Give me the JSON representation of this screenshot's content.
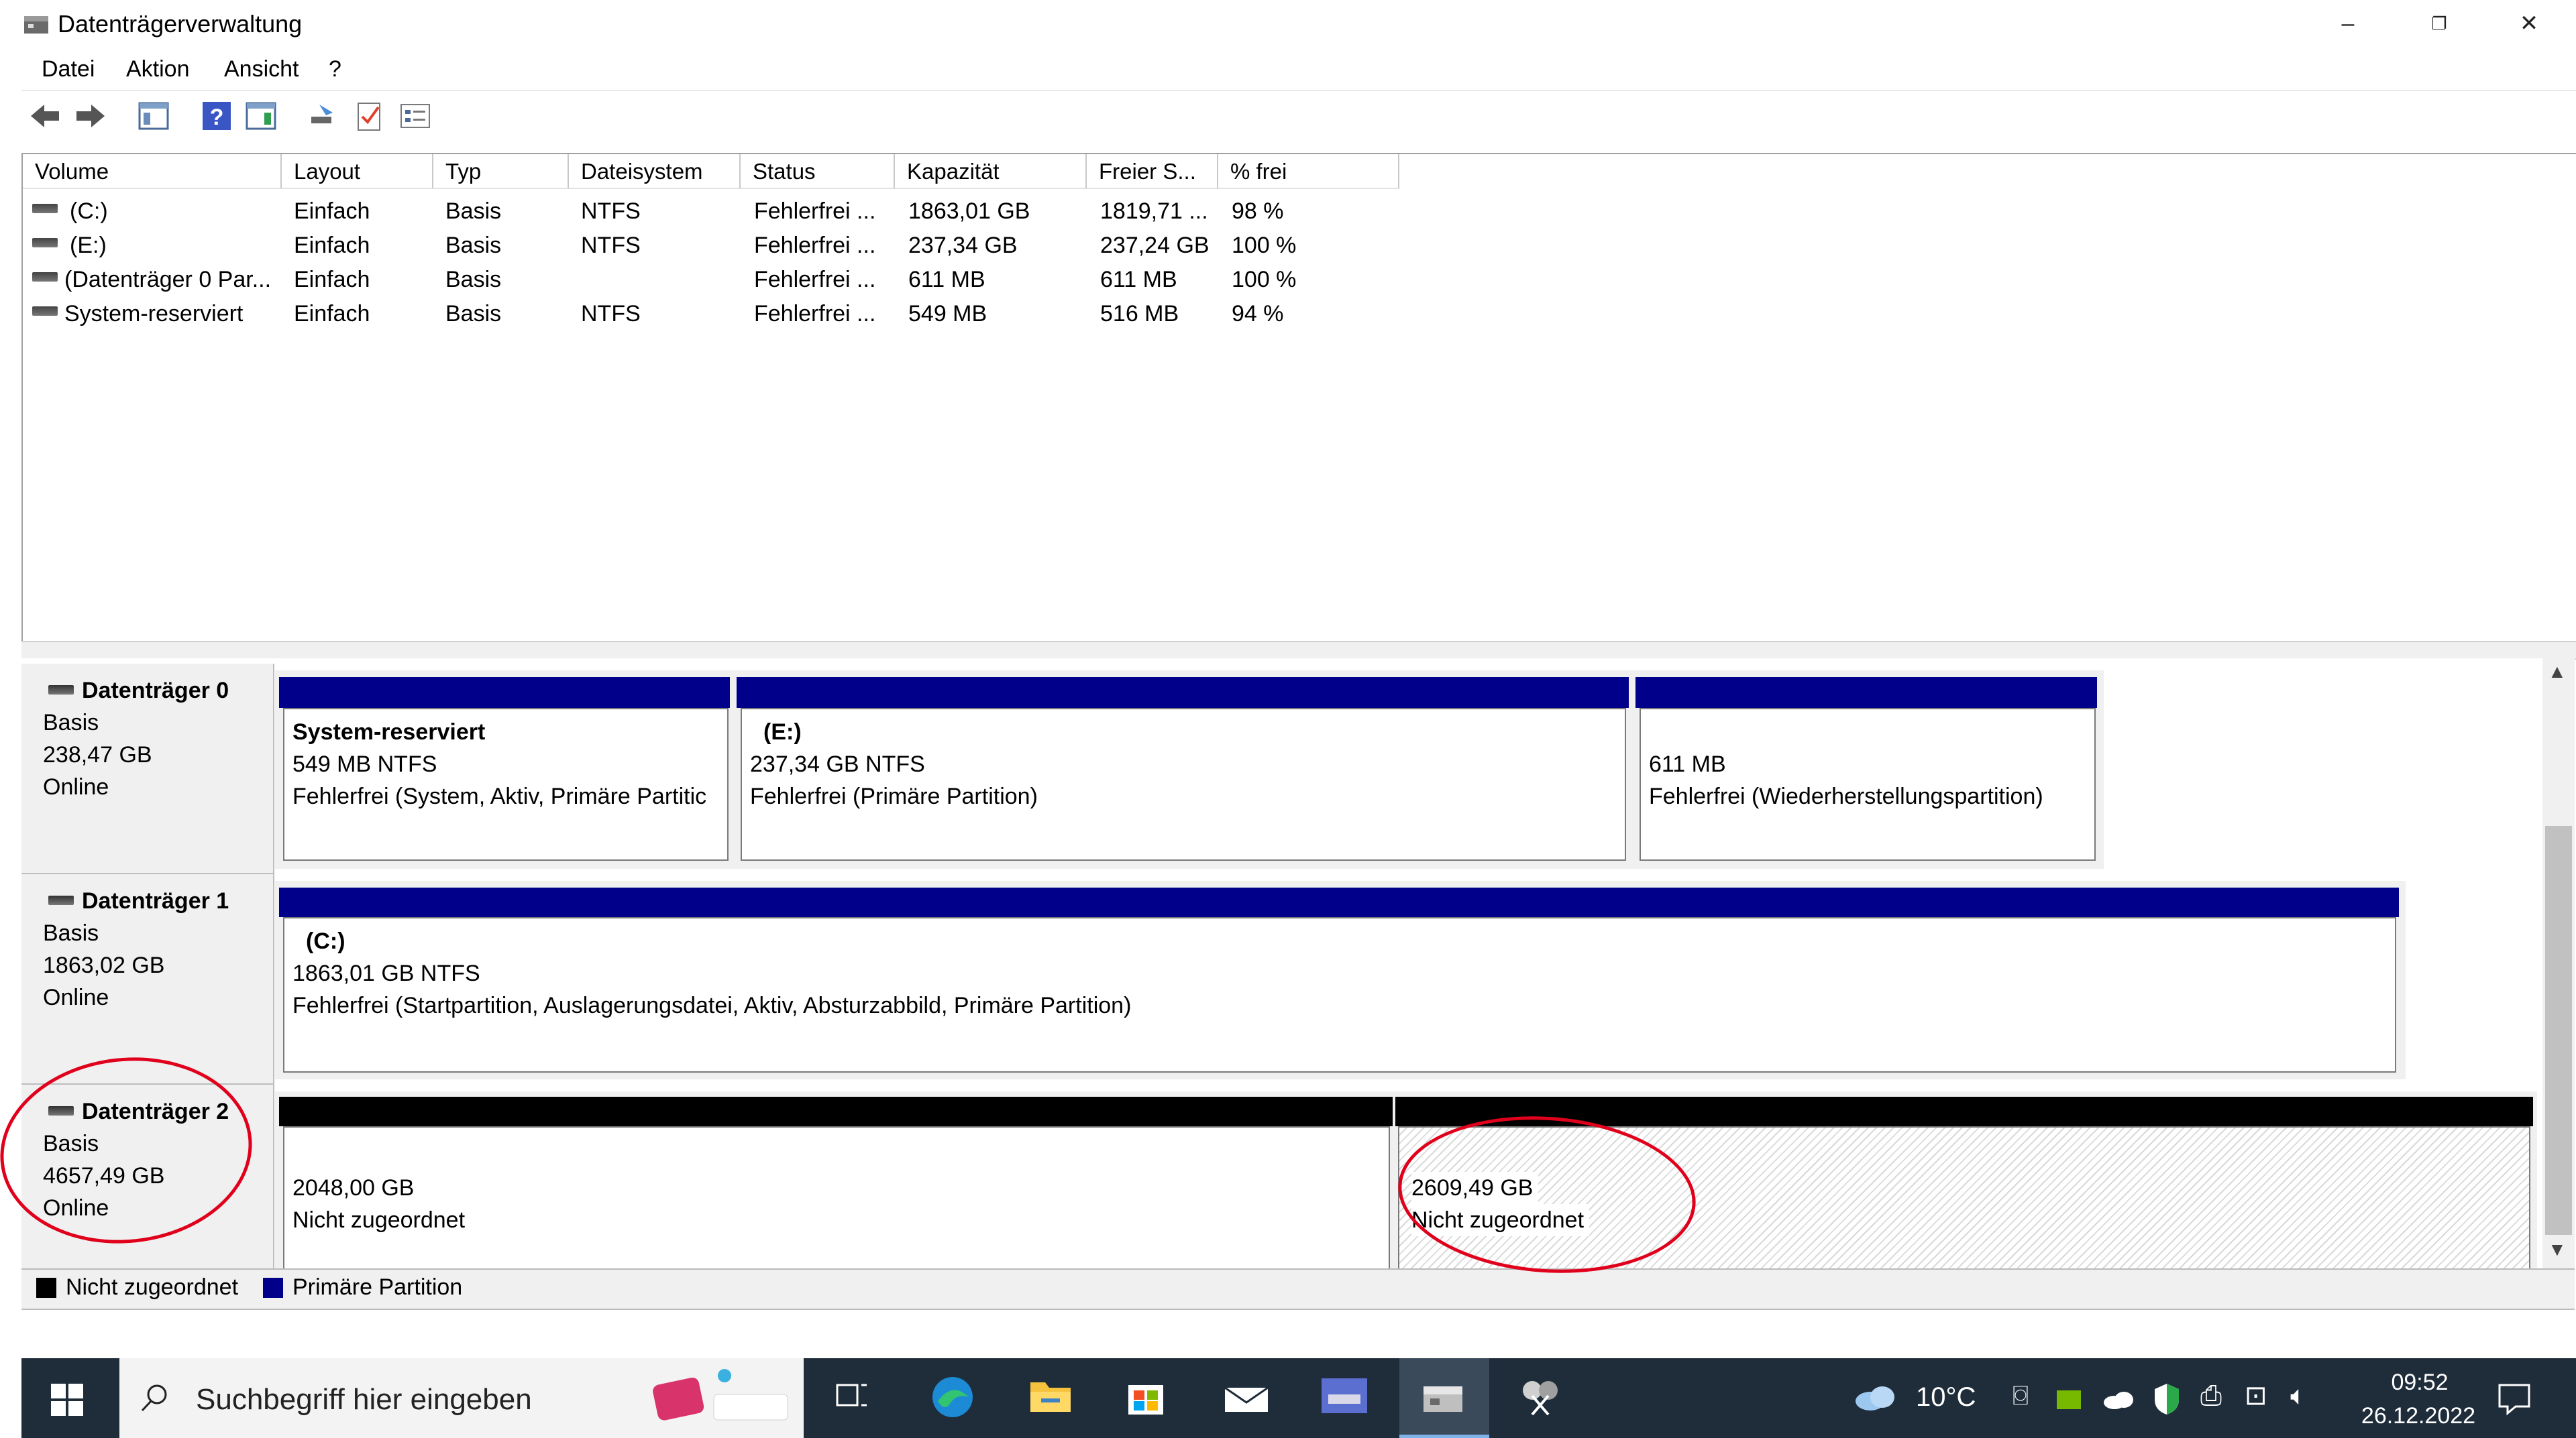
{
  "window": {
    "title": "Datenträgerverwaltung"
  },
  "menu": {
    "items": [
      "Datei",
      "Aktion",
      "Ansicht",
      "?"
    ]
  },
  "columns": [
    "Volume",
    "Layout",
    "Typ",
    "Dateisystem",
    "Status",
    "Kapazität",
    "Freier S...",
    "% frei"
  ],
  "volumes": [
    {
      "name": "(C:)",
      "layout": "Einfach",
      "type": "Basis",
      "fs": "NTFS",
      "status": "Fehlerfrei ...",
      "capacity": "1863,01 GB",
      "free": "1819,71 ...",
      "pct": "98 %"
    },
    {
      "name": "(E:)",
      "layout": "Einfach",
      "type": "Basis",
      "fs": "NTFS",
      "status": "Fehlerfrei ...",
      "capacity": "237,34 GB",
      "free": "237,24 GB",
      "pct": "100 %"
    },
    {
      "name": "(Datenträger 0 Par...",
      "layout": "Einfach",
      "type": "Basis",
      "fs": "",
      "status": "Fehlerfrei ...",
      "capacity": "611 MB",
      "free": "611 MB",
      "pct": "100 %"
    },
    {
      "name": "System-reserviert",
      "layout": "Einfach",
      "type": "Basis",
      "fs": "NTFS",
      "status": "Fehlerfrei ...",
      "capacity": "549 MB",
      "free": "516 MB",
      "pct": "94 %"
    }
  ],
  "disks": [
    {
      "title": "Datenträger 0",
      "type": "Basis",
      "size": "238,47 GB",
      "state": "Online",
      "partitions": [
        {
          "name": "System-reserviert",
          "size": "549 MB NTFS",
          "status": "Fehlerfrei (System, Aktiv, Primäre Partitic"
        },
        {
          "name": "(E:)",
          "size": "237,34 GB NTFS",
          "status": "Fehlerfrei (Primäre Partition)"
        },
        {
          "name": "",
          "size": "611 MB",
          "status": "Fehlerfrei (Wiederherstellungspartition)"
        }
      ]
    },
    {
      "title": "Datenträger 1",
      "type": "Basis",
      "size": "1863,02 GB",
      "state": "Online",
      "partitions": [
        {
          "name": "(C:)",
          "size": "1863,01 GB NTFS",
          "status": "Fehlerfrei (Startpartition, Auslagerungsdatei, Aktiv, Absturzabbild, Primäre Partition)"
        }
      ]
    },
    {
      "title": "Datenträger 2",
      "type": "Basis",
      "size": "4657,49 GB",
      "state": "Online",
      "partitions": [
        {
          "size": "2048,00 GB",
          "status": "Nicht zugeordnet"
        },
        {
          "size": "2609,49 GB",
          "status": "Nicht zugeordnet"
        }
      ]
    }
  ],
  "legend": {
    "unallocated": "Nicht zugeordnet",
    "primary": "Primäre Partition"
  },
  "taskbar": {
    "search_placeholder": "Suchbegriff hier eingeben",
    "weather": "10°C",
    "time": "09:52",
    "date": "26.12.2022"
  },
  "colors": {
    "primary_partition": "#00008b",
    "unallocated": "#000000",
    "annotation": "#e0001b",
    "taskbar": "#1f2d3a"
  }
}
